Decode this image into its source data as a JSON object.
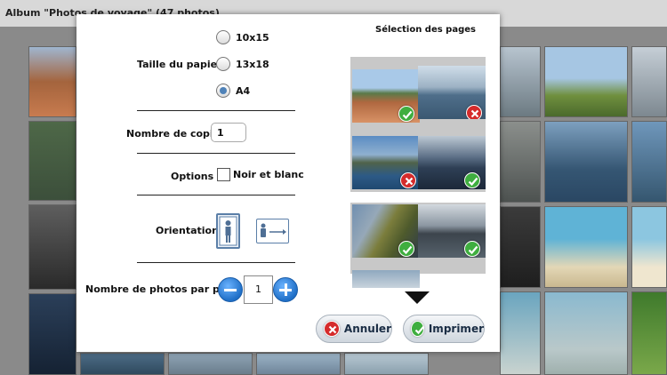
{
  "album": {
    "title": "Album \"Photos de voyage\" (47 photos)"
  },
  "dialog": {
    "paper": {
      "label": "Taille du papier",
      "options": [
        "10x15",
        "13x18",
        "A4"
      ],
      "selected": "A4"
    },
    "copies": {
      "label": "Nombre de copies",
      "value": "1"
    },
    "options": {
      "label": "Options",
      "checkbox_label": "Noir et blanc",
      "checked": false
    },
    "orientation": {
      "label": "Orientation",
      "selected": "portrait",
      "icons": [
        "portrait-person-icon",
        "landscape-person-icon"
      ]
    },
    "photos_per_page": {
      "label": "Nombre de photos par page",
      "value": "1"
    },
    "pages": {
      "title": "Sélection des pages",
      "items": [
        {
          "status": "selected"
        },
        {
          "status": "excluded"
        },
        {
          "status": "excluded"
        },
        {
          "status": "selected"
        },
        {
          "status": "selected"
        },
        {
          "status": "selected"
        }
      ]
    },
    "buttons": {
      "cancel": "Annuler",
      "print": "Imprimer"
    }
  },
  "colors": {
    "accent_blue": "#1f6fc7",
    "ok_green": "#3fae3f",
    "error_red": "#d52b2b"
  }
}
